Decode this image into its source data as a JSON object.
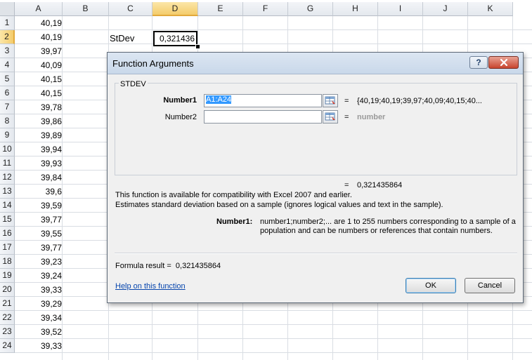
{
  "spreadsheet": {
    "columns": [
      "A",
      "B",
      "C",
      "D",
      "E",
      "F",
      "G",
      "H",
      "I",
      "J",
      "K"
    ],
    "selected_column": "D",
    "rows": [
      {
        "num": "1",
        "a": "40,19"
      },
      {
        "num": "2",
        "a": "40,19"
      },
      {
        "num": "3",
        "a": "39,97"
      },
      {
        "num": "4",
        "a": "40,09"
      },
      {
        "num": "5",
        "a": "40,15"
      },
      {
        "num": "6",
        "a": "40,15"
      },
      {
        "num": "7",
        "a": "39,78"
      },
      {
        "num": "8",
        "a": "39,86"
      },
      {
        "num": "9",
        "a": "39,89"
      },
      {
        "num": "10",
        "a": "39,94"
      },
      {
        "num": "11",
        "a": "39,93"
      },
      {
        "num": "12",
        "a": "39,84"
      },
      {
        "num": "13",
        "a": "39,6"
      },
      {
        "num": "14",
        "a": "39,59"
      },
      {
        "num": "15",
        "a": "39,77"
      },
      {
        "num": "16",
        "a": "39,55"
      },
      {
        "num": "17",
        "a": "39,77"
      },
      {
        "num": "18",
        "a": "39,23"
      },
      {
        "num": "19",
        "a": "39,24"
      },
      {
        "num": "20",
        "a": "39,33"
      },
      {
        "num": "21",
        "a": "39,29"
      },
      {
        "num": "22",
        "a": "39,34"
      },
      {
        "num": "23",
        "a": "39,52"
      },
      {
        "num": "24",
        "a": "39,33"
      }
    ],
    "selected_row": "2",
    "c2_label": "StDev",
    "d2_value": "0,321436"
  },
  "dialog": {
    "title": "Function Arguments",
    "help_button": "?",
    "close_button": "X",
    "function_name": "STDEV",
    "args": [
      {
        "label": "Number1",
        "value": "A1:A24",
        "equals": "=",
        "result": "{40,19;40,19;39,97;40,09;40,15;40..."
      },
      {
        "label": "Number2",
        "value": "",
        "equals": "=",
        "result": "number"
      }
    ],
    "total_equals": "=",
    "total_result": "0,321435864",
    "compat_note": "This function is available for compatibility with Excel 2007 and earlier.",
    "description": "Estimates standard deviation based on a sample (ignores logical values and text in the sample).",
    "param_name": "Number1:",
    "param_desc_line1": "number1;number2;... are 1 to 255 numbers corresponding to a sample of a",
    "param_desc_line2": "population and can be numbers or references that contain numbers.",
    "formula_result_label": "Formula result =",
    "formula_result_value": "0,321435864",
    "help_link": "Help on this function",
    "ok_label": "OK",
    "cancel_label": "Cancel"
  },
  "colors": {
    "selection_header": "#f4cc6b",
    "link": "#0645ad",
    "dialog_bg": "#f0f0f0"
  }
}
